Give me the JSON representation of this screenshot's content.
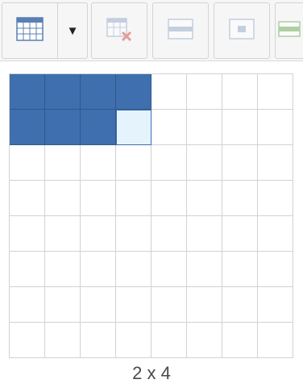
{
  "toolbar": {
    "table_button_icon": "table-grid-icon",
    "dropdown_arrow": "▼",
    "delete_table_icon": "delete-table-icon",
    "row_props_icon": "row-properties-icon",
    "cell_props_icon": "cell-properties-icon",
    "more_icon": "insert-icon"
  },
  "grid_picker": {
    "rows": 8,
    "cols": 8,
    "selected_rows": 2,
    "selected_cols": 4,
    "selected_color": "#3f6faf",
    "hover_color": "#e5f3fc"
  },
  "status_text": "2 x 4"
}
